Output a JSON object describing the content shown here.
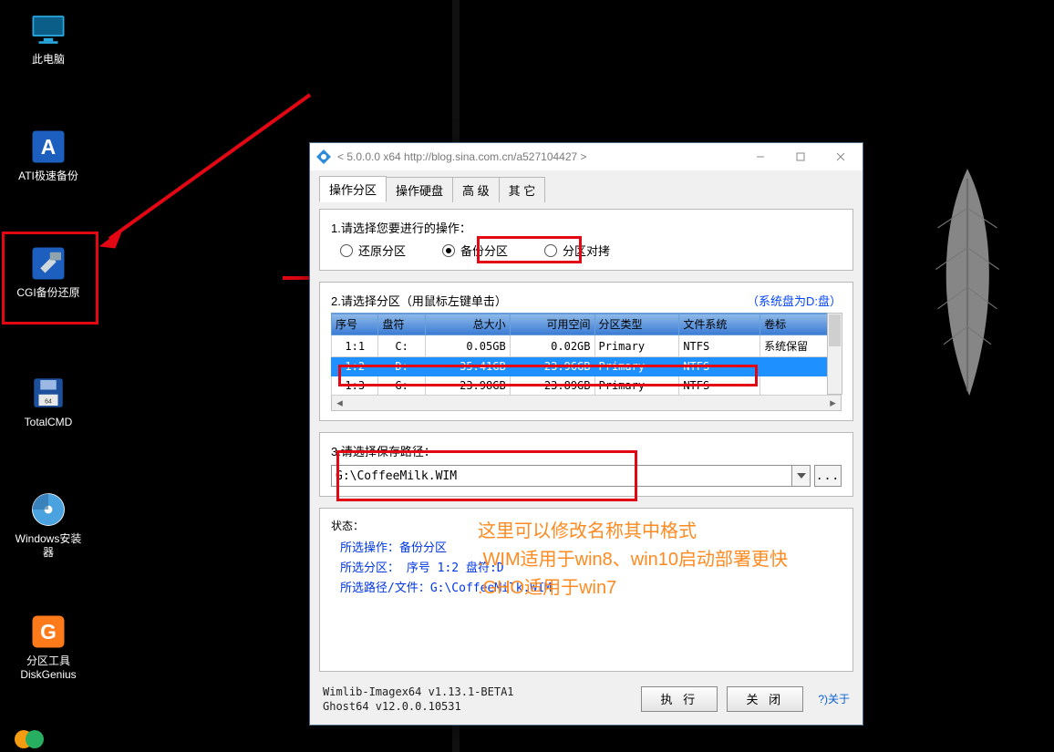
{
  "desktop": {
    "icons": [
      {
        "name": "this-pc",
        "label": "此电脑"
      },
      {
        "name": "ati-backup",
        "label": "ATI极速备份"
      },
      {
        "name": "cgi-backup",
        "label": "CGI备份还原"
      },
      {
        "name": "totalcmd",
        "label": "TotalCMD"
      },
      {
        "name": "win-installer",
        "label": "Windows安装器"
      },
      {
        "name": "diskgenius",
        "label": "分区工具\nDiskGenius"
      }
    ]
  },
  "window": {
    "title": "< 5.0.0.0 x64 http://blog.sina.com.cn/a527104427 >",
    "tabs": [
      "操作分区",
      "操作硬盘",
      "高 级",
      "其 它"
    ],
    "active_tab": 0,
    "section1_label": "1.请选择您要进行的操作：",
    "operations": [
      {
        "key": "restore",
        "label": "还原分区",
        "selected": false
      },
      {
        "key": "backup",
        "label": "备份分区",
        "selected": true
      },
      {
        "key": "clone",
        "label": "分区对拷",
        "selected": false
      }
    ],
    "section2_label": "2.请选择分区（用鼠标左键单击）",
    "system_drive_hint": "（系统盘为D:盘）",
    "table_headers": [
      "序号",
      "盘符",
      "总大小",
      "可用空间",
      "分区类型",
      "文件系统",
      "卷标"
    ],
    "partitions": [
      {
        "idx": "1:1",
        "drv": "C:",
        "total": "0.05GB",
        "free": "0.02GB",
        "ptype": "Primary",
        "fs": "NTFS",
        "vol": "系统保留",
        "selected": false
      },
      {
        "idx": "1:2",
        "drv": "D:",
        "total": "35.41GB",
        "free": "23.96GB",
        "ptype": "Primary",
        "fs": "NTFS",
        "vol": "",
        "selected": true
      },
      {
        "idx": "1:3",
        "drv": "G:",
        "total": "23.98GB",
        "free": "23.89GB",
        "ptype": "Primary",
        "fs": "NTFS",
        "vol": "",
        "selected": false
      }
    ],
    "section3_label": "3.请选择保存路径：",
    "save_path": "G:\\CoffeeMilk.WIM",
    "browse_label": "...",
    "status_title": "状态：",
    "status": {
      "op_line": "所选操作：备份分区",
      "part_line": "所选分区：  序号 1:2      盘符:D",
      "path_line": "所选路径/文件：G:\\CoffeeMilk.WIM"
    },
    "ver1": "Wimlib-Imagex64 v1.13.1-BETA1",
    "ver2": "Ghost64 v12.0.0.10531",
    "btn_run": "执 行",
    "btn_close": "关 闭",
    "about": "?)关于"
  },
  "annotation": {
    "line1": "这里可以修改名称其中格式",
    "line2": ".WIM适用于win8、win10启动部署更快",
    "line3": ".GHO适用于win7"
  }
}
